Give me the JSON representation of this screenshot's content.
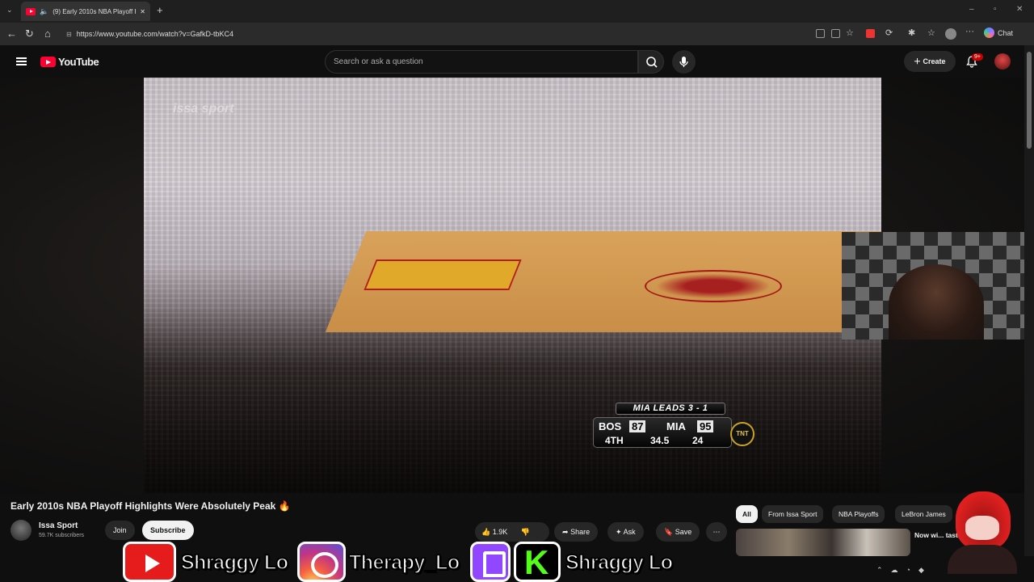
{
  "browser": {
    "tab_title": "(9) Early 2010s NBA Playoff Highlights Were Absolutely Peak",
    "new_tab": "+",
    "url": "https://www.youtube.com/watch?v=GafkD-tbKC4",
    "chat_label": "Chat"
  },
  "youtube": {
    "logo_text": "YouTube",
    "search_placeholder": "Search or ask a question",
    "create_label": "Create",
    "notification_count": "9+"
  },
  "video": {
    "watermark": "issa sport",
    "scorebug": {
      "series_text": "MIA LEADS 3 - 1",
      "team1": "BOS",
      "score1": "87",
      "team2": "MIA",
      "score2": "95",
      "quarter": "4TH",
      "clock": "34.5",
      "shot_clock": "24",
      "network": "TNT"
    }
  },
  "info": {
    "title": "Early 2010s NBA Playoff Highlights Were Absolutely Peak 🔥",
    "channel_name": "Issa Sport",
    "subscribers": "59.7K subscribers",
    "join_label": "Join",
    "subscribe_label": "Subscribe",
    "likes": "1.9K",
    "share_label": "Share",
    "ask_label": "Ask",
    "save_label": "Save"
  },
  "chips": [
    "All",
    "From Issa Sport",
    "NBA Playoffs",
    "LeBron James"
  ],
  "recommendation": {
    "title_partial": "Now wi... taste"
  },
  "overlay": {
    "youtube_handle": "Shraggy Lo",
    "instagram_handle": "Therapy_Lo",
    "kick_handle": "Shraggy Lo"
  }
}
